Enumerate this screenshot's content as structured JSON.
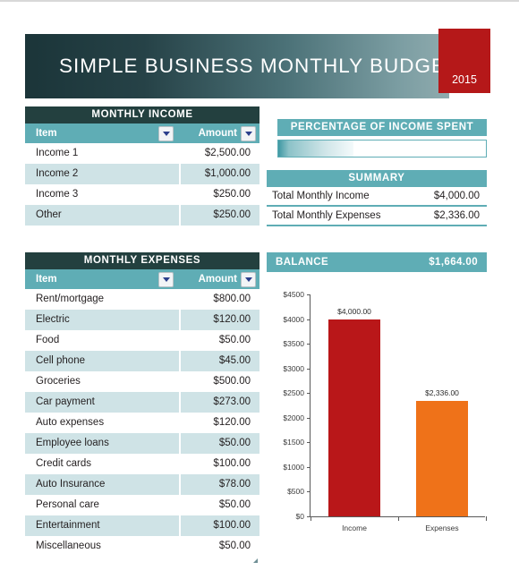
{
  "header": {
    "title": "SIMPLE BUSINESS MONTHLY BUDGET",
    "year": "2015",
    "accent_red": "#b51819",
    "gradient_dark": "#1b3539",
    "gradient_light": "#8fabae"
  },
  "theme": {
    "section_title_bg": "#23403f",
    "teal": "#5fadb5",
    "row_alt": "#cfe3e6"
  },
  "income": {
    "section_label": "MONTHLY INCOME",
    "columns": [
      "Item",
      "Amount"
    ],
    "rows": [
      {
        "item": "Income 1",
        "amount": "$2,500.00"
      },
      {
        "item": "Income 2",
        "amount": "$1,000.00"
      },
      {
        "item": "Income 3",
        "amount": "$250.00"
      },
      {
        "item": "Other",
        "amount": "$250.00"
      }
    ]
  },
  "expenses": {
    "section_label": "MONTHLY EXPENSES",
    "columns": [
      "Item",
      "Amount"
    ],
    "rows": [
      {
        "item": "Rent/mortgage",
        "amount": "$800.00"
      },
      {
        "item": "Electric",
        "amount": "$120.00"
      },
      {
        "item": "Food",
        "amount": "$50.00"
      },
      {
        "item": "Cell phone",
        "amount": "$45.00"
      },
      {
        "item": "Groceries",
        "amount": "$500.00"
      },
      {
        "item": "Car payment",
        "amount": "$273.00"
      },
      {
        "item": "Auto expenses",
        "amount": "$120.00"
      },
      {
        "item": "Employee loans",
        "amount": "$50.00"
      },
      {
        "item": "Credit cards",
        "amount": "$100.00"
      },
      {
        "item": "Auto Insurance",
        "amount": "$78.00"
      },
      {
        "item": "Personal care",
        "amount": "$50.00"
      },
      {
        "item": "Entertainment",
        "amount": "$100.00"
      },
      {
        "item": "Miscellaneous",
        "amount": "$50.00"
      }
    ]
  },
  "percentage_spent": {
    "label": "PERCENTAGE OF INCOME SPENT",
    "fill_percent": 36
  },
  "summary": {
    "label": "SUMMARY",
    "rows": [
      {
        "label": "Total Monthly Income",
        "value": "$4,000.00"
      },
      {
        "label": "Total Monthly Expenses",
        "value": "$2,336.00"
      }
    ]
  },
  "balance": {
    "label": "BALANCE",
    "value": "$1,664.00"
  },
  "chart_data": {
    "type": "bar",
    "title": "",
    "xlabel": "",
    "ylabel": "",
    "categories": [
      "Income",
      "Expenses"
    ],
    "values": [
      4000,
      2336
    ],
    "data_labels": [
      "$4,000.00",
      "$2,336.00"
    ],
    "colors": [
      "#b91719",
      "#ef7219"
    ],
    "ylim": [
      0,
      4500
    ],
    "yticks": [
      0,
      500,
      1000,
      1500,
      2000,
      2500,
      3000,
      3500,
      4000,
      4500
    ],
    "ytick_labels": [
      "$0",
      "$500",
      "$1000",
      "$1500",
      "$2000",
      "$2500",
      "$3000",
      "$3500",
      "$4000",
      "$4500"
    ],
    "grid": false,
    "legend": false
  }
}
